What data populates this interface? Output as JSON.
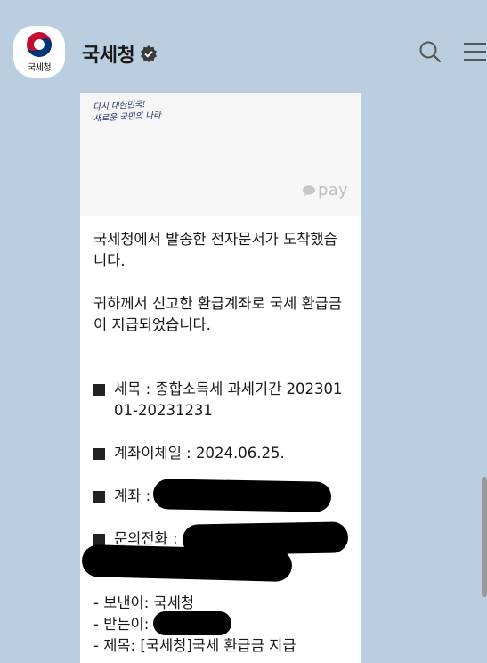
{
  "header": {
    "logo_label": "국세청",
    "channel_name": "국세청",
    "icons": [
      "taegeuk-logo-icon",
      "verified-badge-icon",
      "search-icon",
      "hamburger-menu-icon"
    ]
  },
  "banner": {
    "slogan_line1": "다시 대한민국!",
    "slogan_line2": "새로운 국민의 나라",
    "pay_label": "pay"
  },
  "message": {
    "intro": "국세청에서 발송한 전자문서가 도착했습니다.",
    "notice": "귀하께서 신고한 환급계좌로 국세 환급금이 지급되었습니다.",
    "tax_item_label": "세목 :",
    "tax_item_value": "종합소득세 과세기간 20230101-20231231",
    "transfer_date_label": "계좌이체일 :",
    "transfer_date_value": "2024.06.25.",
    "account_label": "계좌 :",
    "inquiry_label": "문의전화 :",
    "sender_line": "- 보낸이: 국세청",
    "recipient_line": "- 받는이:",
    "subject_line": "- 제목: [국세청]국세 환급금 지급"
  },
  "colors": {
    "background": "#bacee0",
    "bubble": "#ffffff",
    "banner": "#f6f6f6",
    "text": "#191919"
  }
}
